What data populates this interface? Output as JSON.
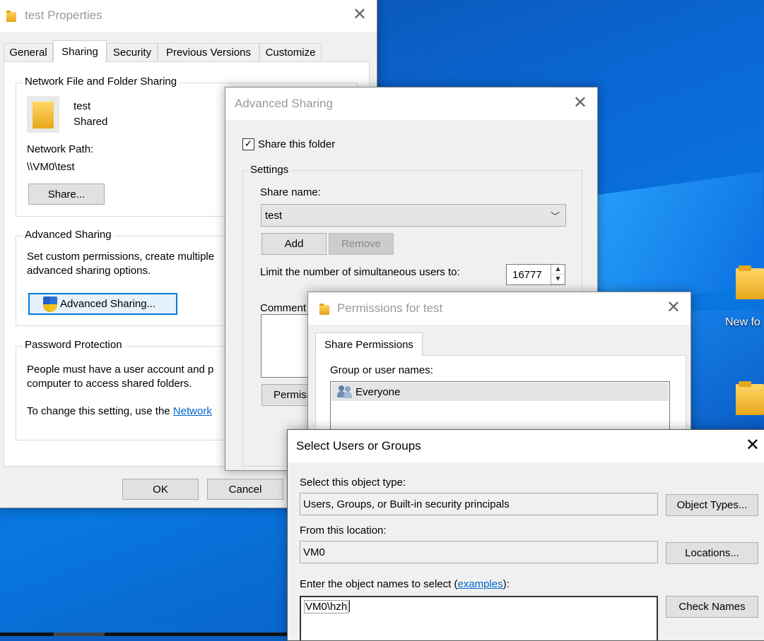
{
  "desktop": {
    "icons": [
      {
        "label": "New fo"
      },
      {
        "label": ""
      }
    ]
  },
  "properties": {
    "title": "test Properties",
    "tabs": [
      "General",
      "Sharing",
      "Security",
      "Previous Versions",
      "Customize"
    ],
    "selected_tab": "Sharing",
    "network_sharing": {
      "group_label": "Network File and Folder Sharing",
      "folder_name": "test",
      "status": "Shared",
      "path_label": "Network Path:",
      "path": "\\\\VM0\\test",
      "share_button": "Share..."
    },
    "advanced": {
      "group_label": "Advanced Sharing",
      "description_line1": "Set custom permissions, create multiple",
      "description_line2": "advanced sharing options.",
      "button": "Advanced Sharing..."
    },
    "password": {
      "group_label": "Password Protection",
      "line1": "People must have a user account and p",
      "line2": "computer to access shared folders.",
      "line3": "To change this setting, use the ",
      "link": "Network"
    },
    "ok": "OK",
    "cancel": "Cancel"
  },
  "advanced_sharing": {
    "title": "Advanced Sharing",
    "share_checkbox_label": "Share this folder",
    "share_checked": "✓",
    "settings_label": "Settings",
    "share_name_label": "Share name:",
    "share_name_value": "test",
    "add": "Add",
    "remove": "Remove",
    "limit_label": "Limit the number of simultaneous users to:",
    "limit_value": "16777",
    "comments_label": "Comment",
    "permissions_button": "Permiss"
  },
  "permissions": {
    "title": "Permissions for test",
    "tab": "Share Permissions",
    "group_label": "Group or user names:",
    "entries": [
      "Everyone"
    ]
  },
  "select_users": {
    "title": "Select Users or Groups",
    "object_type_label": "Select this object type:",
    "object_type_value": "Users, Groups, or Built-in security principals",
    "object_types_button": "Object Types...",
    "location_label": "From this location:",
    "location_value": "VM0",
    "locations_button": "Locations...",
    "enter_label_prefix": "Enter the object names to select (",
    "examples_link": "examples",
    "enter_label_suffix": "):",
    "names_value": "VM0\\hzh",
    "check_names_button": "Check Names"
  },
  "colors": {
    "desktop_blue": "#0a68d6",
    "dialog_bg": "#f0f0f0",
    "focus_blue": "#0078d7",
    "link_blue": "#0066cc"
  }
}
